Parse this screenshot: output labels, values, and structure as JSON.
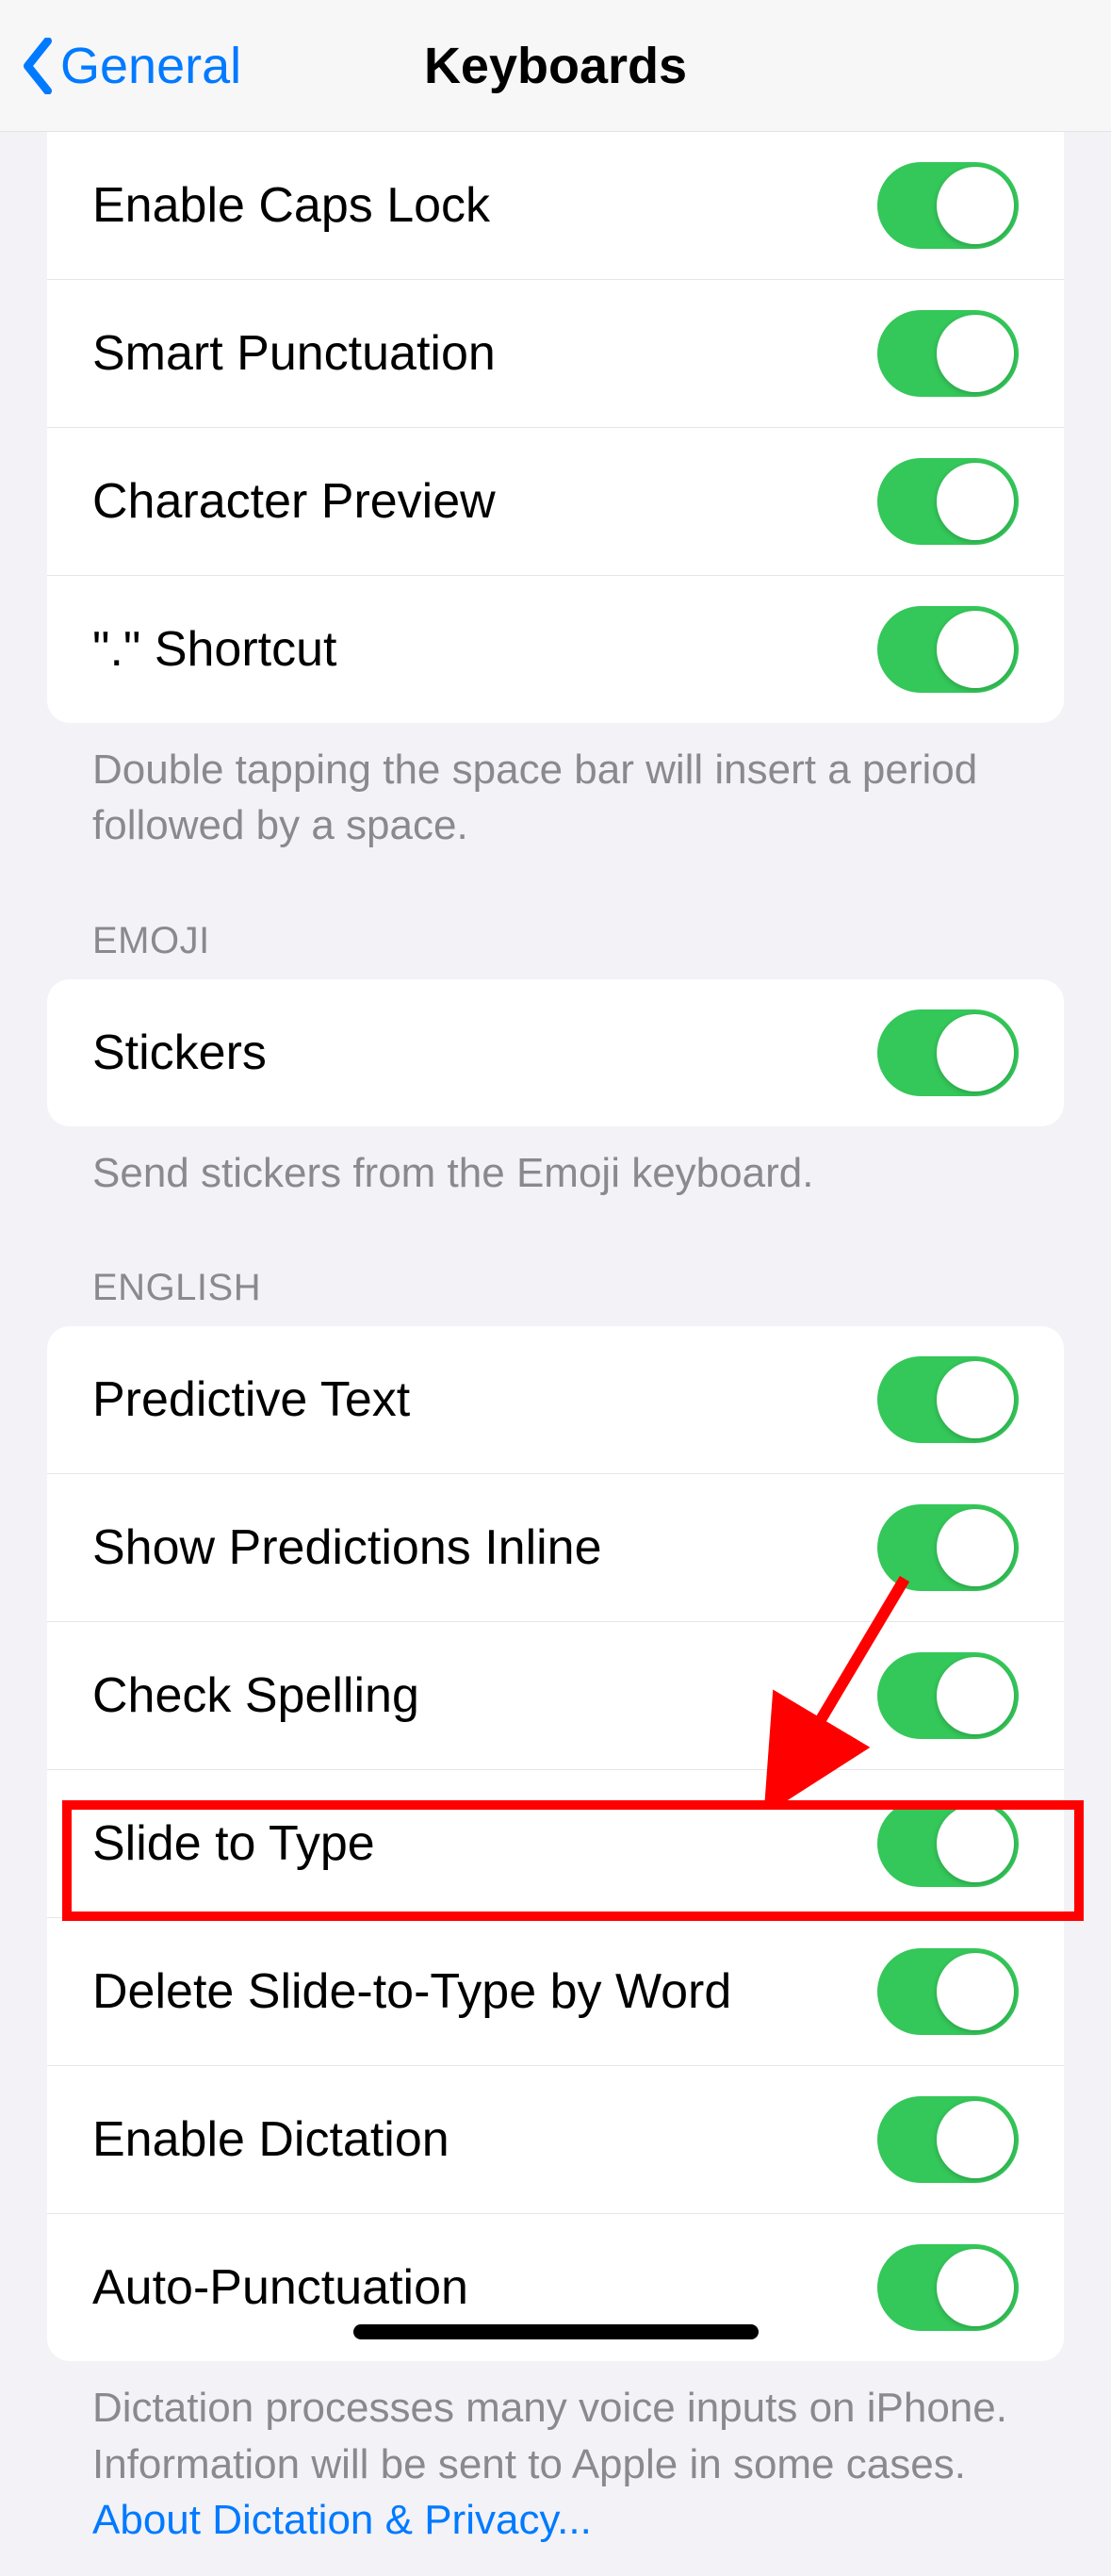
{
  "nav": {
    "back_label": "General",
    "title": "Keyboards"
  },
  "group1": {
    "rows": [
      {
        "label": "Enable Caps Lock"
      },
      {
        "label": "Smart Punctuation"
      },
      {
        "label": "Character Preview"
      },
      {
        "label": "\".\" Shortcut"
      }
    ],
    "footer": "Double tapping the space bar will insert a period followed by a space."
  },
  "emoji": {
    "header": "EMOJI",
    "rows": [
      {
        "label": "Stickers"
      }
    ],
    "footer": "Send stickers from the Emoji keyboard."
  },
  "english": {
    "header": "ENGLISH",
    "rows": [
      {
        "label": "Predictive Text"
      },
      {
        "label": "Show Predictions Inline"
      },
      {
        "label": "Check Spelling"
      },
      {
        "label": "Slide to Type"
      },
      {
        "label": "Delete Slide-to-Type by Word"
      },
      {
        "label": "Enable Dictation"
      },
      {
        "label": "Auto-Punctuation"
      }
    ],
    "footer_text": "Dictation processes many voice inputs on iPhone. Information will be sent to Apple in some cases. ",
    "footer_link": "About Dictation & Privacy..."
  }
}
